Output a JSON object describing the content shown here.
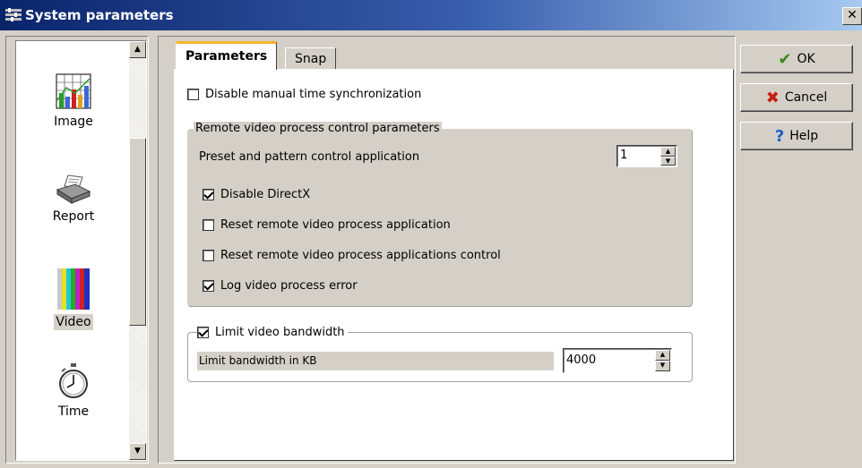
{
  "window": {
    "title": "System parameters",
    "close_label": "✕"
  },
  "nav": {
    "items": [
      {
        "label": "Image",
        "icon": "chart-icon"
      },
      {
        "label": "Report",
        "icon": "printer-icon"
      },
      {
        "label": "Video",
        "icon": "color-bars-icon",
        "selected": true
      },
      {
        "label": "Time",
        "icon": "stopwatch-icon"
      }
    ],
    "scroll_up": "▲",
    "scroll_down": "▼"
  },
  "tabs": [
    {
      "label": "Parameters",
      "active": true
    },
    {
      "label": "Snap",
      "active": false
    }
  ],
  "parameters": {
    "disable_manual_time_sync": {
      "label": "Disable manual time synchronization",
      "checked": false
    },
    "remote_group": {
      "legend": "Remote video process control parameters",
      "preset_label": "Preset and pattern control application",
      "preset_value": "1",
      "options": [
        {
          "label": "Disable DirectX",
          "checked": true
        },
        {
          "label": "Reset remote video process application",
          "checked": false
        },
        {
          "label": "Reset remote video process applications control",
          "checked": false
        },
        {
          "label": "Log video process error",
          "checked": true
        }
      ]
    },
    "bandwidth_group": {
      "legend": "Limit video bandwidth",
      "checked": true,
      "limit_label": "Limit bandwidth in KB",
      "limit_value": "4000"
    }
  },
  "buttons": {
    "ok": {
      "label": "OK",
      "icon": "✔",
      "color": "#3a8a1a"
    },
    "cancel": {
      "label": "Cancel",
      "icon": "✖",
      "color": "#c82010"
    },
    "help": {
      "label": "Help",
      "icon": "?",
      "color": "#1f5fc8"
    }
  }
}
